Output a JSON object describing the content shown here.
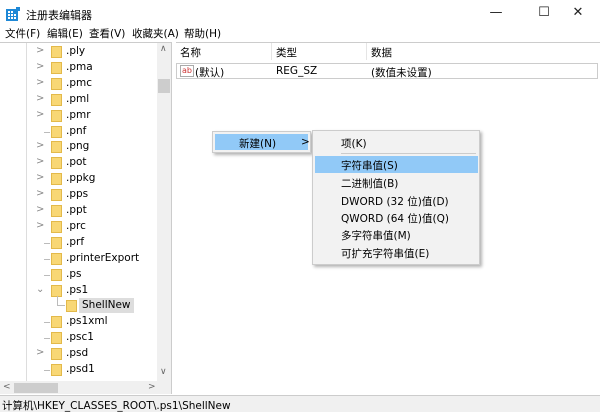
{
  "window": {
    "title": "注册表编辑器",
    "minimize": "—",
    "maximize": "☐",
    "close": "✕"
  },
  "menubar": [
    "文件(F)",
    "编辑(E)",
    "查看(V)",
    "收藏夹(A)",
    "帮助(H)"
  ],
  "tree": [
    {
      "label": ".ply",
      "chevron": ">"
    },
    {
      "label": ".pma",
      "chevron": ">"
    },
    {
      "label": ".pmc",
      "chevron": ">"
    },
    {
      "label": ".pml",
      "chevron": ">"
    },
    {
      "label": ".pmr",
      "chevron": ">"
    },
    {
      "label": ".pnf",
      "chevron": ""
    },
    {
      "label": ".png",
      "chevron": ">"
    },
    {
      "label": ".pot",
      "chevron": ">"
    },
    {
      "label": ".ppkg",
      "chevron": ">"
    },
    {
      "label": ".pps",
      "chevron": ">"
    },
    {
      "label": ".ppt",
      "chevron": ">"
    },
    {
      "label": ".prc",
      "chevron": ">"
    },
    {
      "label": ".prf",
      "chevron": ""
    },
    {
      "label": ".printerExport",
      "chevron": ""
    },
    {
      "label": ".ps",
      "chevron": ""
    },
    {
      "label": ".ps1",
      "chevron": "⌄"
    },
    {
      "label": "ShellNew",
      "chevron": "",
      "child": true
    },
    {
      "label": ".ps1xml",
      "chevron": ""
    },
    {
      "label": ".psc1",
      "chevron": ""
    },
    {
      "label": ".psd",
      "chevron": ">"
    },
    {
      "label": ".psd1",
      "chevron": ""
    }
  ],
  "columns": {
    "name": "名称",
    "type": "类型",
    "data": "数据"
  },
  "values": [
    {
      "icon": "ab",
      "name": "(默认)",
      "type": "REG_SZ",
      "data": "(数值未设置)"
    }
  ],
  "context_menu": {
    "new_label": "新建(N)",
    "arrow": ">"
  },
  "submenu": [
    "项(K)",
    "字符串值(S)",
    "二进制值(B)",
    "DWORD (32 位)值(D)",
    "QWORD (64 位)值(Q)",
    "多字符串值(M)",
    "可扩充字符串值(E)"
  ],
  "status": "计算机\\HKEY_CLASSES_ROOT\\.ps1\\ShellNew"
}
